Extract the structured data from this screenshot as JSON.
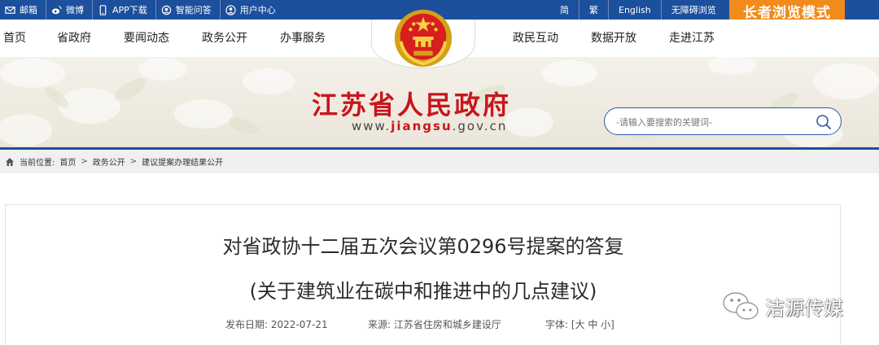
{
  "topbar": {
    "left_items": [
      {
        "label": "邮箱",
        "icon": "mail-icon"
      },
      {
        "label": "微博",
        "icon": "weibo-icon"
      },
      {
        "label": "APP下载",
        "icon": "phone-icon"
      },
      {
        "label": "智能问答",
        "icon": "chat-icon"
      },
      {
        "label": "用户中心",
        "icon": "user-icon"
      }
    ],
    "right_items": [
      "简",
      "繁",
      "English",
      "无障碍浏览"
    ],
    "elder_mode": "长者浏览模式"
  },
  "nav": {
    "left": [
      "首页",
      "省政府",
      "要闻动态",
      "政务公开",
      "办事服务"
    ],
    "right": [
      "政民互动",
      "数据开放",
      "走进江苏"
    ]
  },
  "banner": {
    "site_title": "江苏省人民政府",
    "url_prefix": "www.",
    "url_domain": "jiangsu",
    "url_suffix": ".gov.cn",
    "search_placeholder": "-请输入要搜索的关键词-"
  },
  "breadcrumb": {
    "label": "当前位置:",
    "items": [
      "首页",
      "政务公开",
      "建议提案办理结果公开"
    ],
    "separator": ">"
  },
  "article": {
    "title": "对省政协十二届五次会议第0296号提案的答复",
    "subtitle": "(关于建筑业在碳中和推进中的几点建议)",
    "date_label": "发布日期:",
    "date": "2022-07-21",
    "source_label": "来源:",
    "source": "江苏省住房和城乡建设厅",
    "font_label": "字体:",
    "font_options": "[大 中 小]"
  },
  "watermark": {
    "text": "洁源传媒",
    "icon": "wechat-icon"
  },
  "colors": {
    "brand_blue": "#1c4f9c",
    "title_red": "#c8161d",
    "elder_orange": "#f28b1c"
  }
}
